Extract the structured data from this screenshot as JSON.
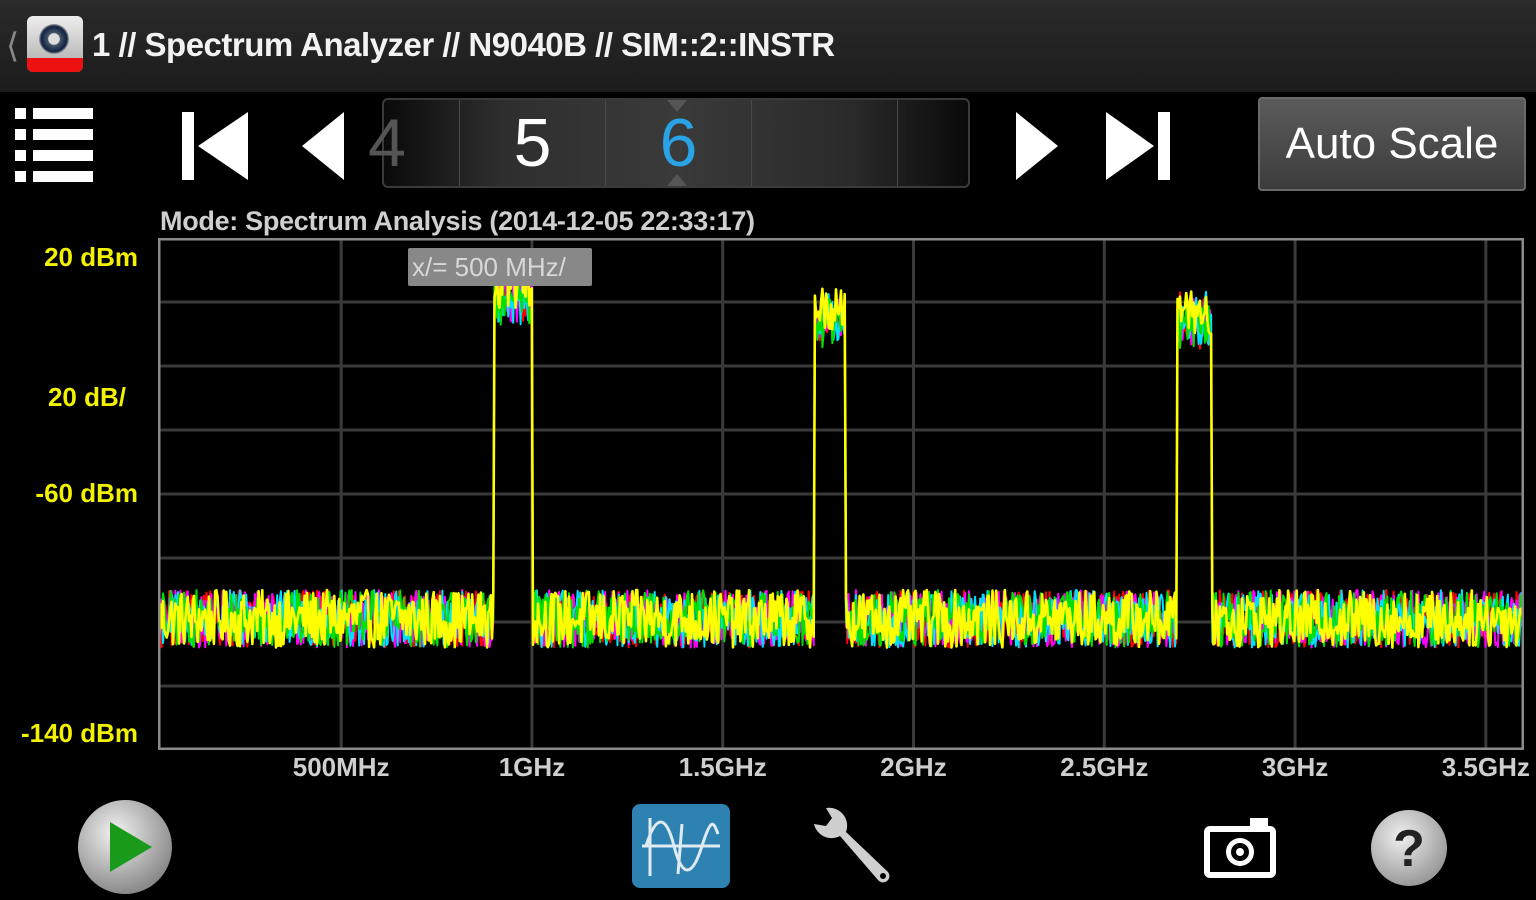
{
  "window": {
    "title": "1 // Spectrum Analyzer // N9040B // SIM::2::INSTR"
  },
  "toolbar": {
    "pages": {
      "previous": "4",
      "left": "5",
      "current": "6"
    },
    "auto_scale_label": "Auto Scale"
  },
  "chart": {
    "mode_label": "Mode: Spectrum Analysis (2014-12-05 22:33:17)",
    "x_scale_badge": "x/= 500 MHz/",
    "y_labels": {
      "top": "20 dBm",
      "scale": "20 dB/",
      "mid": "-60 dBm",
      "bottom": "-140 dBm"
    }
  },
  "chart_data": {
    "type": "line",
    "title": "",
    "xlabel": "",
    "ylabel": "",
    "x_unit": "MHz",
    "y_unit": "dBm",
    "xlim": [
      20,
      3600
    ],
    "ylim": [
      -140,
      20
    ],
    "x_tick_values": [
      500,
      1000,
      1500,
      2000,
      2500,
      3000,
      3500
    ],
    "x_tick_labels": [
      "500MHz",
      "1GHz",
      "1.5GHz",
      "2GHz",
      "2.5GHz",
      "3GHz",
      "3.5GHz"
    ],
    "y_ticks": [
      20,
      -60,
      -140
    ],
    "grid": true,
    "noise_floor": {
      "min": -108,
      "max": -90
    },
    "signals": [
      {
        "start": 900,
        "end": 1000,
        "peak": 12
      },
      {
        "start": 1740,
        "end": 1820,
        "peak": 5
      },
      {
        "start": 2690,
        "end": 2780,
        "peak": 4
      }
    ],
    "series": [
      {
        "color": "#ffff00"
      },
      {
        "color": "#00e000"
      },
      {
        "color": "#00e0ff"
      },
      {
        "color": "#ff00ff"
      },
      {
        "color": "#ff0000"
      }
    ]
  }
}
